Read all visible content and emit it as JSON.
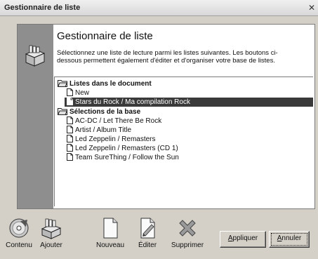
{
  "window": {
    "title": "Gestionnaire de liste"
  },
  "dialog": {
    "heading": "Gestionnaire de liste",
    "description": "Sélectionnez une liste de lecture parmi les listes suivantes. Les boutons ci-dessous permettent également d'éditer et d'organiser votre base de listes."
  },
  "tree": {
    "groups": [
      {
        "label": "Listes dans le document",
        "items": [
          {
            "label": "New",
            "selected": false
          },
          {
            "label": "Stars du Rock / Ma compilation Rock",
            "selected": true
          }
        ]
      },
      {
        "label": "Sélections de la base",
        "items": [
          {
            "label": "AC-DC / Let There Be Rock",
            "selected": false
          },
          {
            "label": "Artist / Album Title",
            "selected": false
          },
          {
            "label": "Led Zeppelin / Remasters",
            "selected": false
          },
          {
            "label": "Led Zeppelin / Remasters (CD 1)",
            "selected": false
          },
          {
            "label": "Team SureThing / Follow the Sun",
            "selected": false
          }
        ]
      }
    ]
  },
  "toolbar": {
    "contenu": "Contenu",
    "ajouter": "Ajouter",
    "nouveau": "Nouveau",
    "editer": "Éditer",
    "supprimer": "Supprimer"
  },
  "buttons": {
    "apply_mnemonic": "A",
    "apply_rest": "ppliquer",
    "cancel_mnemonic": "A",
    "cancel_rest": "nnuler"
  },
  "colors": {
    "dialog_background": "#d4d0c8",
    "sidebar": "#8e8e8e",
    "selection": "#3a3a3a"
  }
}
